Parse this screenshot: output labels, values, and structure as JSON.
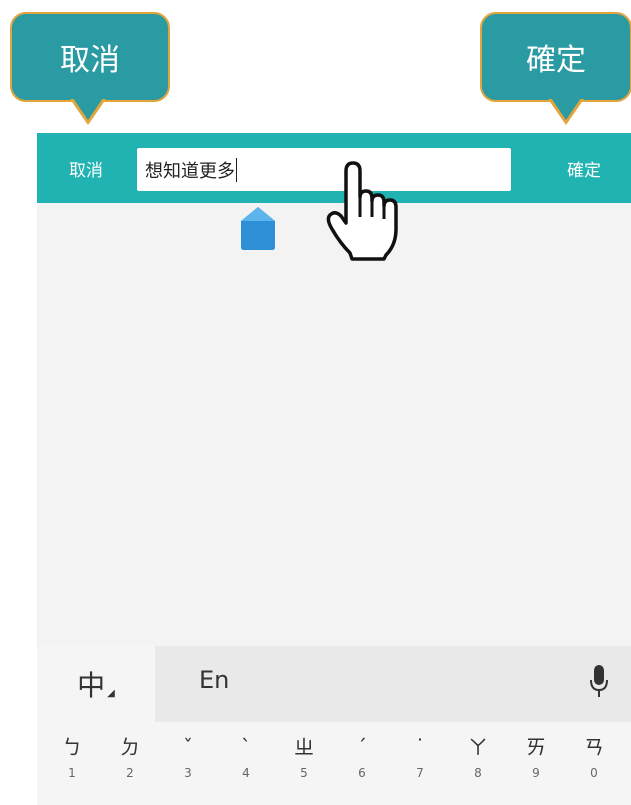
{
  "callouts": {
    "left_label": "取消",
    "right_label": "確定"
  },
  "header": {
    "cancel_label": "取消",
    "confirm_label": "確定",
    "search_value": "想知道更多"
  },
  "keyboard": {
    "mode_label": "中",
    "english_label": "En",
    "keys": [
      {
        "sym": "ㄅ",
        "num": "1"
      },
      {
        "sym": "ㄉ",
        "num": "2"
      },
      {
        "sym": "ˇ",
        "num": "3"
      },
      {
        "sym": "ˋ",
        "num": "4"
      },
      {
        "sym": "ㄓ",
        "num": "5"
      },
      {
        "sym": "ˊ",
        "num": "6"
      },
      {
        "sym": "˙",
        "num": "7"
      },
      {
        "sym": "ㄚ",
        "num": "8"
      },
      {
        "sym": "ㄞ",
        "num": "9"
      },
      {
        "sym": "ㄢ",
        "num": "0"
      }
    ]
  },
  "colors": {
    "bar": "#20b3b1",
    "callout": "#2a9aa3",
    "callout_border": "#e3a43c",
    "handle": "#2f8fd6"
  },
  "icons": [
    "pointer-hand-icon",
    "text-handle-icon",
    "microphone-icon"
  ]
}
